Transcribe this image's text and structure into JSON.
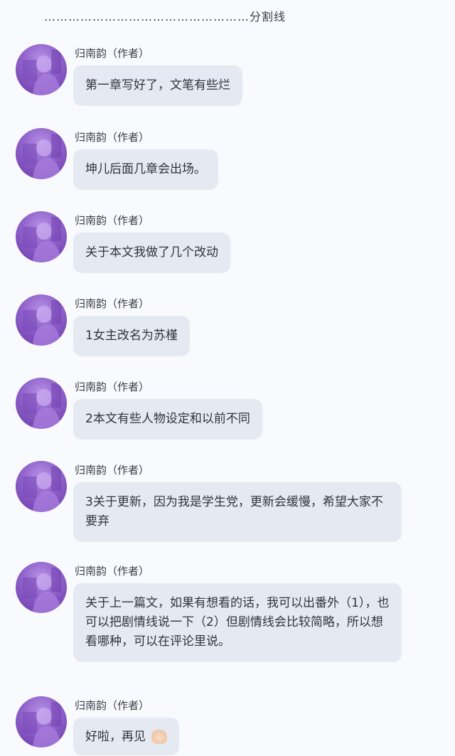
{
  "divider": "……………………………………………分割线",
  "messages": [
    {
      "name": "归南韵（作者）",
      "text": "第一章写好了，文笔有些烂"
    },
    {
      "name": "归南韵（作者）",
      "text": "坤儿后面几章会出场。"
    },
    {
      "name": "归南韵（作者）",
      "text": "关于本文我做了几个改动"
    },
    {
      "name": "归南韵（作者）",
      "text": "1女主改名为苏槿"
    },
    {
      "name": "归南韵（作者）",
      "text": "2本文有些人物设定和以前不同"
    },
    {
      "name": "归南韵（作者）",
      "text": "3关于更新，因为我是学生党，更新会缓慢，希望大家不要弃"
    },
    {
      "name": "归南韵（作者）",
      "text": "关于上一篇文，如果有想看的话，我可以出番外（1），也可以把剧情线说一下（2）但剧情线会比较简略，所以想看哪种，可以在评论里说。"
    },
    {
      "name": "归南韵（作者）",
      "text": "好啦，再见",
      "emoji": "waving-hand-icon"
    }
  ],
  "colors": {
    "background": "#f9fafd",
    "bubble": "#e5e9f1",
    "avatar": "#8e60c9"
  }
}
